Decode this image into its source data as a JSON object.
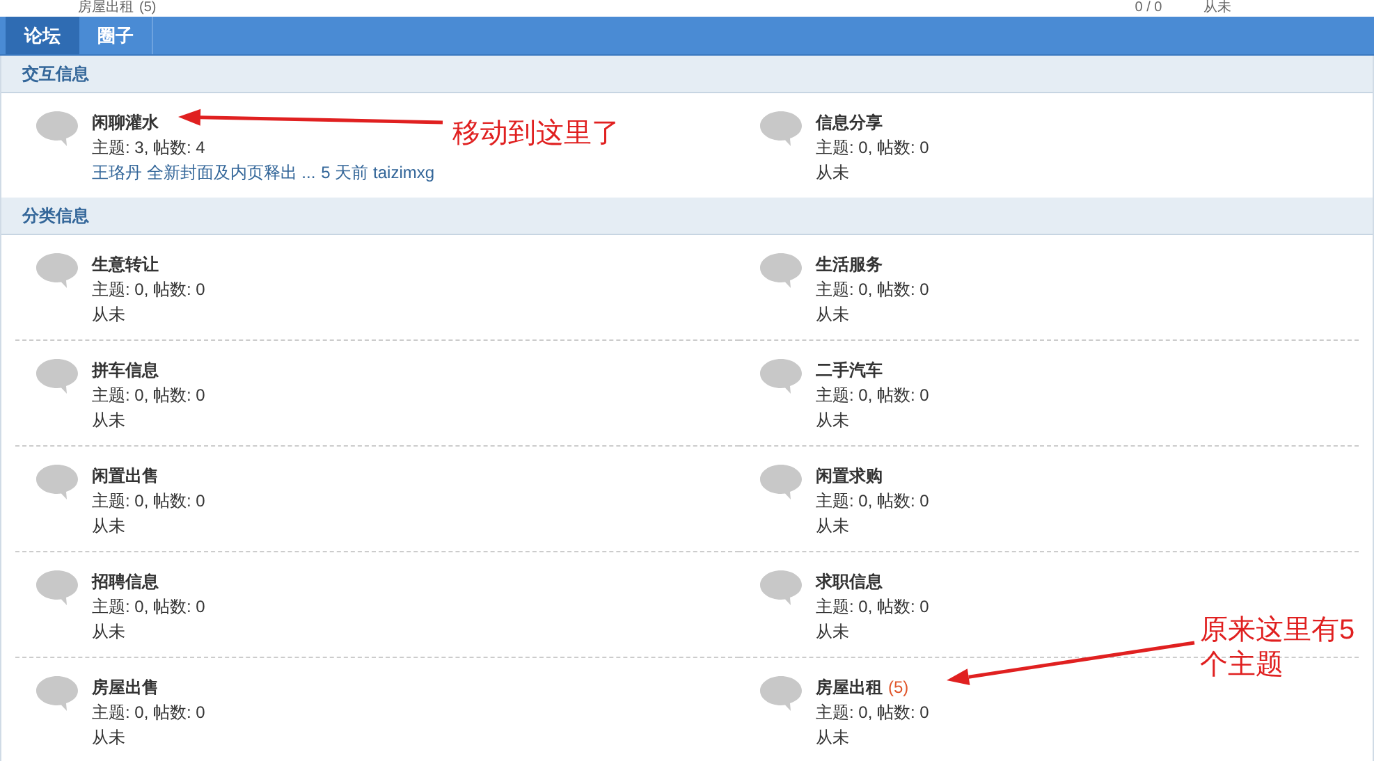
{
  "behind_strip": {
    "forum": "房屋出租",
    "count": "(5)",
    "stats": "0 / 0",
    "last": "从未"
  },
  "tabs": [
    {
      "label": "论坛",
      "selected": true
    },
    {
      "label": "圈子",
      "selected": false
    }
  ],
  "sections": [
    {
      "title": "交互信息",
      "forums": [
        {
          "name": "闲聊灌水",
          "stats": "主题: 3, 帖数: 4",
          "last_link": "王珞丹 全新封面及内页释出 ...",
          "last_meta": "5 天前 taizimxg"
        },
        {
          "name": "信息分享",
          "stats": "主题: 0, 帖数: 0",
          "last": "从未"
        }
      ]
    },
    {
      "title": "分类信息",
      "forums": [
        {
          "name": "生意转让",
          "stats": "主题: 0, 帖数: 0",
          "last": "从未"
        },
        {
          "name": "生活服务",
          "stats": "主题: 0, 帖数: 0",
          "last": "从未"
        },
        {
          "name": "拼车信息",
          "stats": "主题: 0, 帖数: 0",
          "last": "从未"
        },
        {
          "name": "二手汽车",
          "stats": "主题: 0, 帖数: 0",
          "last": "从未"
        },
        {
          "name": "闲置出售",
          "stats": "主题: 0, 帖数: 0",
          "last": "从未"
        },
        {
          "name": "闲置求购",
          "stats": "主题: 0, 帖数: 0",
          "last": "从未"
        },
        {
          "name": "招聘信息",
          "stats": "主题: 0, 帖数: 0",
          "last": "从未"
        },
        {
          "name": "求职信息",
          "stats": "主题: 0, 帖数: 0",
          "last": "从未"
        },
        {
          "name": "房屋出售",
          "stats": "主题: 0, 帖数: 0",
          "last": "从未"
        },
        {
          "name": "房屋出租",
          "count": "(5)",
          "stats": "主题: 0, 帖数: 0",
          "last": "从未"
        }
      ]
    }
  ],
  "annotations": [
    {
      "text": "移动到这里了"
    },
    {
      "text": "原来这里有5 个主题"
    }
  ]
}
